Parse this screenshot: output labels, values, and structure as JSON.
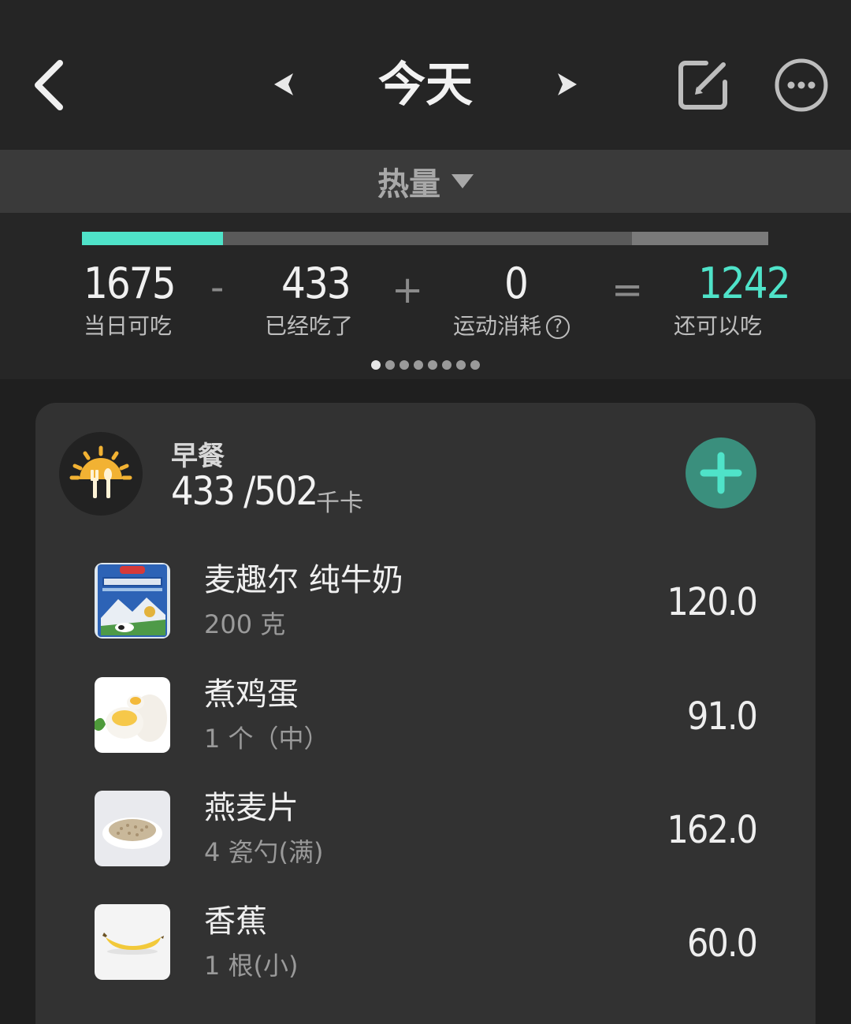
{
  "header": {
    "title": "今天"
  },
  "metric": {
    "label": "热量"
  },
  "summary": {
    "progress": {
      "eaten_fraction": 0.205,
      "remaining_start_fraction": 0.801
    },
    "daily_allowance": {
      "value": "1675",
      "label": "当日可吃"
    },
    "op_minus": "-",
    "eaten": {
      "value": "433",
      "label": "已经吃了"
    },
    "op_plus": "+",
    "exercise": {
      "value": "0",
      "label": "运动消耗",
      "help_icon": "?"
    },
    "op_equals": "=",
    "remaining": {
      "value": "1242",
      "label": "还可以吃",
      "color": "#4fe3c9"
    },
    "page_dots": {
      "count": 8,
      "active": 0
    }
  },
  "meal": {
    "name": "早餐",
    "calories": "433 /502",
    "unit": "千卡",
    "icon": "breakfast-sun-utensils-icon",
    "items": [
      {
        "name": "麦趣尔 纯牛奶",
        "portion": "200 克",
        "kcal": "120.0",
        "thumb": "milk-carton"
      },
      {
        "name": "煮鸡蛋",
        "portion": "1 个（中）",
        "kcal": "91.0",
        "thumb": "boiled-egg"
      },
      {
        "name": "燕麦片",
        "portion": "4 瓷勺(满)",
        "kcal": "162.0",
        "thumb": "oatmeal-bowl"
      },
      {
        "name": "香蕉",
        "portion": "1 根(小)",
        "kcal": "60.0",
        "thumb": "banana"
      }
    ]
  },
  "colors": {
    "accent": "#4fe3c9",
    "add_button": "#3a8f7d",
    "meal_icon_sun": "#f2b233"
  }
}
